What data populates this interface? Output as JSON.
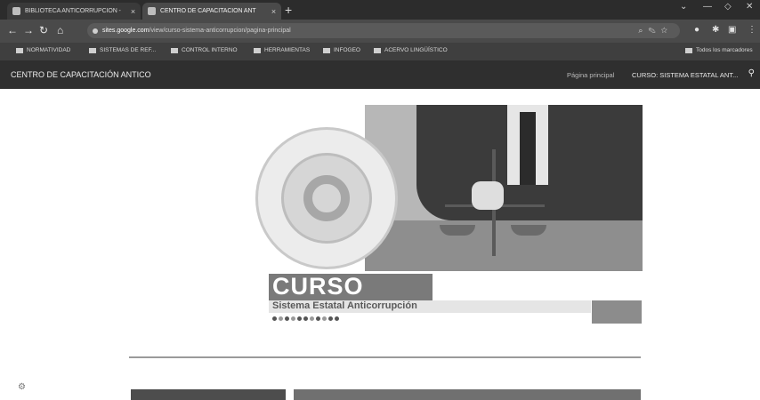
{
  "browser": {
    "tabs": [
      {
        "title": "BIBLIOTECA ANTICORRUPCIÓN -",
        "active": false
      },
      {
        "title": "CENTRO DE CAPACITACIÓN ANT",
        "active": true
      }
    ],
    "new_tab": "+",
    "close_glyph": "×",
    "url_host": "sites.google.com",
    "url_path": "/view/curso-sistema-anticorrupcion/pagina-principal",
    "bookmarks": [
      "NORMATIVIDAD",
      "SISTEMAS DE REF...",
      "CONTROL INTERNO",
      "HERRAMIENTAS",
      "INFOGEO",
      "ACERVO LINGÜÍSTICO"
    ],
    "all_bookmarks": "Todos los marcadores"
  },
  "site": {
    "name": "CENTRO DE CAPACITACIÓN ANTICO",
    "nav": [
      "Página principal",
      "CURSO: SISTEMA ESTATAL ANT..."
    ]
  },
  "hero": {
    "heading": "CURSO",
    "subtitle": "Sistema Estatal Anticorrupción"
  },
  "colors": {
    "tabstrip": "#2c2c2c",
    "toolbar": "#4a4a4a",
    "site_header": "#2f2f2f",
    "banner": "#7a7a7a"
  }
}
